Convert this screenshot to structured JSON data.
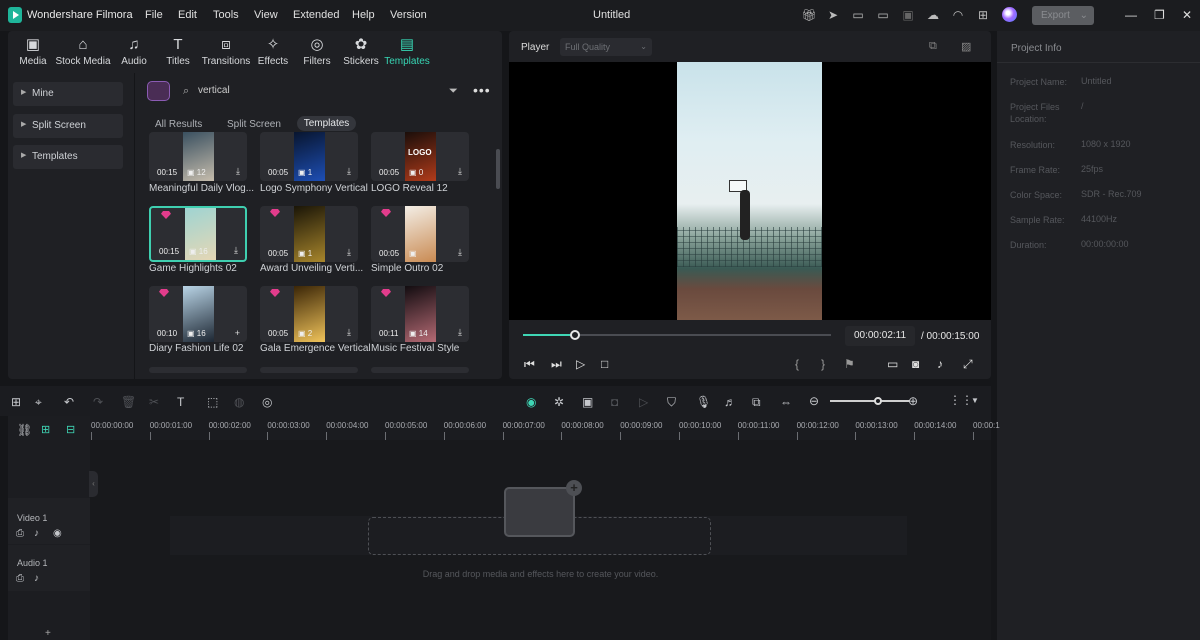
{
  "app": {
    "name": "Wondershare Filmora",
    "doc_title": "Untitled"
  },
  "menu": [
    "File",
    "Edit",
    "Tools",
    "View",
    "Extended",
    "Help",
    "Version"
  ],
  "export": {
    "label": "Export",
    "arrow": "⌄"
  },
  "toolbar": [
    {
      "label": "Media",
      "icon": "▣"
    },
    {
      "label": "Stock Media",
      "icon": "⌂"
    },
    {
      "label": "Audio",
      "icon": "♫"
    },
    {
      "label": "Titles",
      "icon": "T"
    },
    {
      "label": "Transitions",
      "icon": "⧈"
    },
    {
      "label": "Effects",
      "icon": "✧"
    },
    {
      "label": "Filters",
      "icon": "◎"
    },
    {
      "label": "Stickers",
      "icon": "✿"
    },
    {
      "label": "Templates",
      "icon": "▤"
    }
  ],
  "sidebar": [
    {
      "label": "Mine"
    },
    {
      "label": "Split Screen"
    },
    {
      "label": "Templates"
    }
  ],
  "search": {
    "value": "vertical"
  },
  "tabs": {
    "all": "All Results",
    "split": "Split Screen",
    "templates": "Templates"
  },
  "cards": [
    {
      "label": "Meaningful Daily Vlog...",
      "dur": "00:15",
      "count": "12",
      "colors": [
        "#3a5060",
        "#d6c9b5"
      ]
    },
    {
      "label": "Logo Symphony Vertical",
      "dur": "00:05",
      "count": "1",
      "colors": [
        "#08152f",
        "#2055c4"
      ]
    },
    {
      "label": "LOGO Reveal 12",
      "dur": "00:05",
      "count": "0",
      "colors": [
        "#1b0e0a",
        "#c2401c"
      ],
      "text": "LOGO"
    },
    {
      "label": "Game Highlights 02",
      "dur": "00:15",
      "count": "16",
      "colors": [
        "#9fd4d2",
        "#e9d7b3"
      ]
    },
    {
      "label": "Award Unveiling Verti...",
      "dur": "00:05",
      "count": "1",
      "colors": [
        "#1a1507",
        "#a8862c"
      ]
    },
    {
      "label": "Simple Outro 02",
      "dur": "00:05",
      "count": "",
      "colors": [
        "#f3eee6",
        "#c98a52"
      ]
    },
    {
      "label": "Diary Fashion Life 02",
      "dur": "00:10",
      "count": "16",
      "colors": [
        "#b9d4e6",
        "#1d2733"
      ]
    },
    {
      "label": "Gala Emergence Vertical",
      "dur": "00:05",
      "count": "2",
      "colors": [
        "#3b2607",
        "#f0c35a"
      ]
    },
    {
      "label": "Music Festival Style",
      "dur": "00:11",
      "count": "14",
      "colors": [
        "#120c10",
        "#b56a74"
      ]
    }
  ],
  "player": {
    "label": "Player",
    "quality": "Full Quality",
    "current": "00:00:02:11",
    "total": "/  00:00:15:00",
    "progress": 0.17
  },
  "project_info": {
    "title": "Project Info",
    "rows": [
      {
        "label": "Project Name:",
        "value": "Untitled"
      },
      {
        "label": "Project Files\nLocation:",
        "value": "/"
      },
      {
        "label": "Resolution:",
        "value": "1080 x 1920"
      },
      {
        "label": "Frame Rate:",
        "value": "25fps"
      },
      {
        "label": "Color Space:",
        "value": "SDR - Rec.709"
      },
      {
        "label": "Sample Rate:",
        "value": "44100Hz"
      },
      {
        "label": "Duration:",
        "value": "00:00:00:00"
      }
    ]
  },
  "ruler": [
    "00:00:00:00",
    "00:00:01:00",
    "00:00:02:00",
    "00:00:03:00",
    "00:00:04:00",
    "00:00:05:00",
    "00:00:06:00",
    "00:00:07:00",
    "00:00:08:00",
    "00:00:09:00",
    "00:00:10:00",
    "00:00:11:00",
    "00:00:12:00",
    "00:00:13:00",
    "00:00:14:00",
    "00:00:1"
  ],
  "tracks": {
    "video": "Video 1",
    "audio": "Audio 1"
  },
  "drop_text": "Drag and drop media and effects here to create your video.",
  "zoom": 0.6
}
